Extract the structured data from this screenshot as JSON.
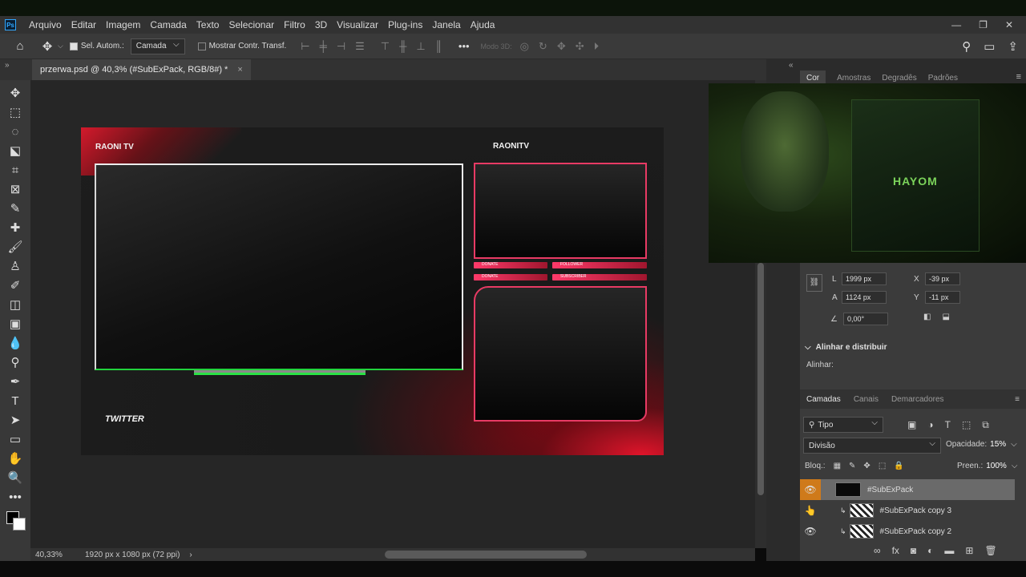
{
  "app": {
    "logo": "Ps"
  },
  "menu": [
    "Arquivo",
    "Editar",
    "Imagem",
    "Camada",
    "Texto",
    "Selecionar",
    "Filtro",
    "3D",
    "Visualizar",
    "Plug-ins",
    "Janela",
    "Ajuda"
  ],
  "options": {
    "auto_select_label": "Sel. Autom.:",
    "auto_select_value": "Camada",
    "transform_label": "Mostrar Contr. Transf.",
    "mode3d_label": "Modo 3D:"
  },
  "document_tab": {
    "title": "przerwa.psd @ 40,3% (#SubExPack, RGB/8#) *",
    "close": "×"
  },
  "status": {
    "zoom": "40,33%",
    "size": "1920 px x 1080 px (72 ppi)",
    "arrow": "›"
  },
  "canvas": {
    "label_tl": "RAONI TV",
    "label_tr": "RAONITV",
    "label_twitter": "TWITTER",
    "bars": [
      {
        "left": "DONATE",
        "right": "FOLLOWER"
      },
      {
        "left": "DONATE",
        "right": "SUBSCRIBER"
      }
    ]
  },
  "panel_tabs": [
    "Cor",
    "Amostras",
    "Degradês",
    "Padrões"
  ],
  "properties": {
    "L_label": "L",
    "L_value": "1999 px",
    "X_label": "X",
    "X_value": "-39 px",
    "A_label": "A",
    "A_value": "1124 px",
    "Y_label": "Y",
    "Y_value": "-11 px",
    "angle_value": "0,00°",
    "align_section": "Alinhar e distribuir",
    "align_label": "Alinhar:"
  },
  "layers_panel": {
    "tabs": [
      "Camadas",
      "Canais",
      "Demarcadores"
    ],
    "filter": "Tipo",
    "blend": "Divisão",
    "opacity_label": "Opacidade:",
    "opacity_value": "15%",
    "lock_label": "Bloq.:",
    "fill_label": "Preen.:",
    "fill_value": "100%",
    "layers": [
      {
        "name": "#SubExPack",
        "visible": true,
        "selected": true
      },
      {
        "name": "#SubExPack copy 3",
        "visible": false,
        "selected": false
      },
      {
        "name": "#SubExPack copy 2",
        "visible": true,
        "selected": false
      }
    ]
  },
  "webcam": {
    "brand": "HAYOM"
  },
  "colors": {
    "accent_red": "#e0142a",
    "accent_pink": "#e83a64",
    "accent_green": "#21d33d",
    "selected_layer": "#cf7a1a"
  }
}
